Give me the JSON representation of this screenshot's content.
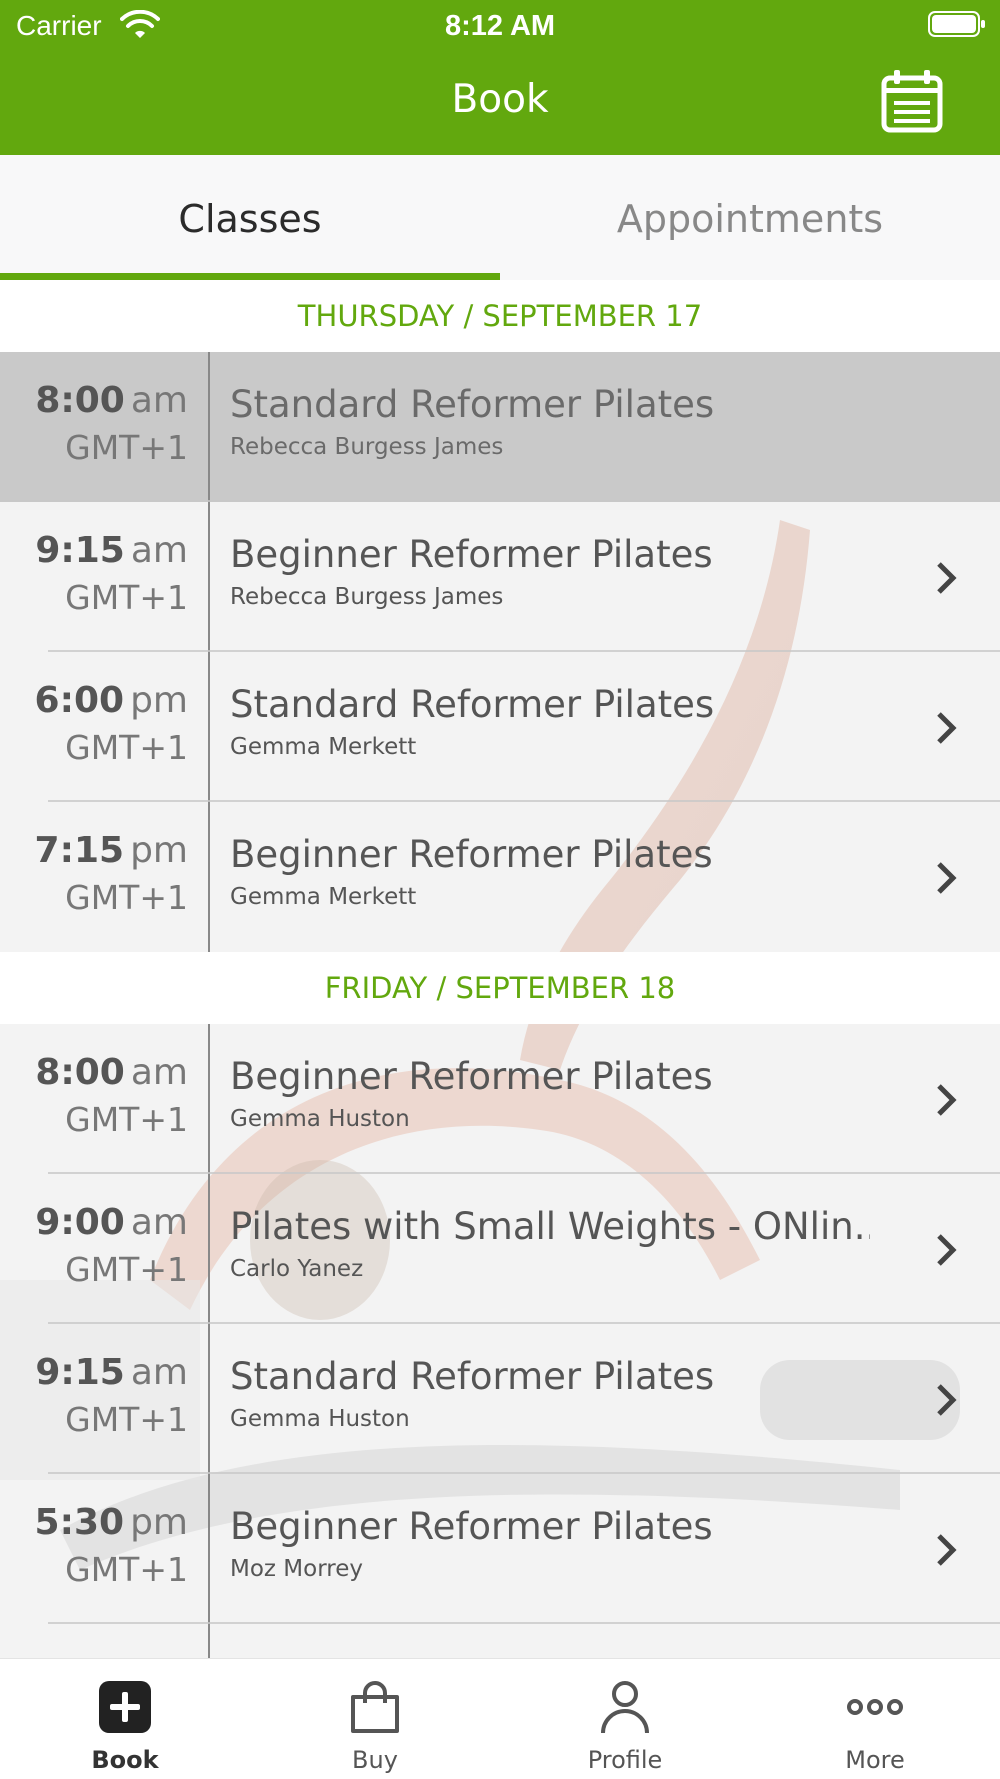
{
  "status_bar": {
    "carrier": "Carrier",
    "time": "8:12 AM"
  },
  "header": {
    "title": "Book",
    "calendar_icon": "calendar-icon"
  },
  "tabs": [
    {
      "label": "Classes",
      "active": true
    },
    {
      "label": "Appointments",
      "active": false
    }
  ],
  "days": [
    {
      "header": "THURSDAY / SEPTEMBER 17",
      "classes": [
        {
          "time": "8:00",
          "ampm": "am",
          "tz": "GMT+1",
          "name": "Standard Reformer Pilates",
          "teacher": "Rebecca Burgess James",
          "selected": true
        },
        {
          "time": "9:15",
          "ampm": "am",
          "tz": "GMT+1",
          "name": "Beginner Reformer Pilates",
          "teacher": "Rebecca Burgess James"
        },
        {
          "time": "6:00",
          "ampm": "pm",
          "tz": "GMT+1",
          "name": "Standard Reformer Pilates",
          "teacher": "Gemma Merkett"
        },
        {
          "time": "7:15",
          "ampm": "pm",
          "tz": "GMT+1",
          "name": "Beginner Reformer Pilates",
          "teacher": "Gemma Merkett"
        }
      ]
    },
    {
      "header": "FRIDAY / SEPTEMBER 18",
      "classes": [
        {
          "time": "8:00",
          "ampm": "am",
          "tz": "GMT+1",
          "name": "Beginner Reformer Pilates",
          "teacher": "Gemma Huston"
        },
        {
          "time": "9:00",
          "ampm": "am",
          "tz": "GMT+1",
          "name": "Pilates with Small Weights - ONlin...",
          "teacher": "Carlo Yanez"
        },
        {
          "time": "9:15",
          "ampm": "am",
          "tz": "GMT+1",
          "name": "Standard Reformer Pilates",
          "teacher": "Gemma Huston"
        },
        {
          "time": "5:30",
          "ampm": "pm",
          "tz": "GMT+1",
          "name": "Beginner Reformer Pilates",
          "teacher": "Moz Morrey"
        }
      ]
    }
  ],
  "tab_bar": [
    {
      "label": "Book",
      "icon": "plus-square-icon",
      "active": true
    },
    {
      "label": "Buy",
      "icon": "shopping-bag-icon",
      "active": false
    },
    {
      "label": "Profile",
      "icon": "person-icon",
      "active": false
    },
    {
      "label": "More",
      "icon": "more-dots-icon",
      "active": false
    }
  ],
  "colors": {
    "brand_green": "#62a80e",
    "header_text": "#ffffff"
  }
}
